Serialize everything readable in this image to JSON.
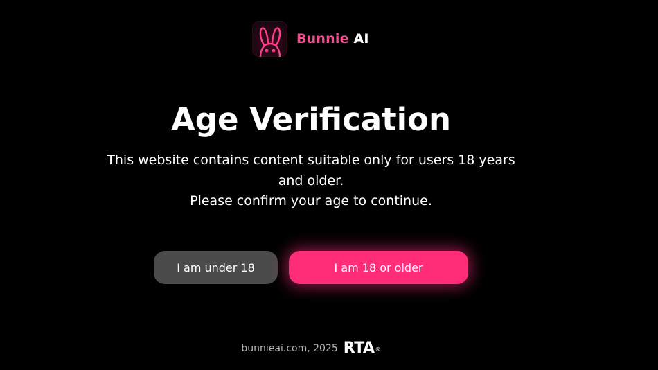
{
  "brand": {
    "name_part1": "Bunnie",
    "name_part2": "AI",
    "logo_icon": "bunny-neon-icon",
    "accent_color": "#f0508f"
  },
  "modal": {
    "title": "Age Verification",
    "description_line1": "This website contains content suitable only for users 18 years",
    "description_line2": "and older.",
    "description_line3": "Please confirm your age to continue."
  },
  "buttons": {
    "under_label": "I am under 18",
    "over_label": "I am 18 or older",
    "under_color": "#4b4b4b",
    "over_color": "#ff2d78"
  },
  "footer": {
    "text": "bunnieai.com, 2025",
    "rta_label": "RTA",
    "rta_reg": "®"
  }
}
